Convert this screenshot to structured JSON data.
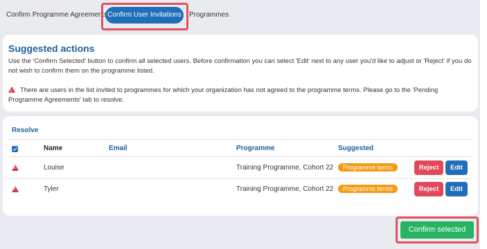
{
  "tabs": [
    {
      "label": "Confirm Programme Agreements"
    },
    {
      "label": "Confirm User Invitations"
    },
    {
      "label": "Programmes"
    }
  ],
  "suggested": {
    "title": "Suggested actions",
    "description": "Use the 'Confirm Selected' button to confirm all selected users. Before confirmation you can select 'Edit' next to any user you'd like to adjust or 'Reject' if you do not wish to confirm them on the programme listed.",
    "warning": "There are users in the list invited to programmes for which your organization has not agreed to the programme terms. Please go to the 'Pending Programme Agreements' tab to resolve."
  },
  "table": {
    "resolve_label": "Resolve",
    "headers": {
      "name": "Name",
      "email": "Email",
      "programme": "Programme",
      "suggested": "Suggested"
    },
    "rows": [
      {
        "name": "Louise",
        "email": "",
        "programme": "Training Programme, Cohort 22",
        "suggested": "Programme terms",
        "reject": "Reject",
        "edit": "Edit"
      },
      {
        "name": "Tyler",
        "email": "",
        "programme": "Training Programme, Cohort 22",
        "suggested": "Programme terms",
        "reject": "Reject",
        "edit": "Edit"
      }
    ]
  },
  "confirm_button": "Confirm selected",
  "colors": {
    "accent": "#1f6fb8",
    "warning": "#d9303f",
    "badge": "#f39b13",
    "success": "#28b463",
    "highlight": "#e5505f"
  }
}
